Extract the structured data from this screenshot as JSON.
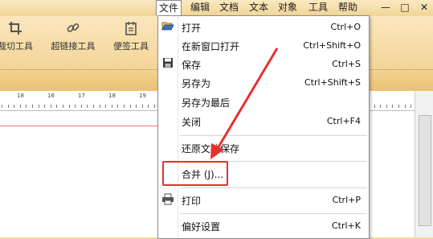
{
  "menubar": {
    "items": [
      "文件",
      "编辑",
      "文档",
      "文本",
      "对象",
      "工具",
      "帮助"
    ],
    "window_controls": [
      "—",
      "□",
      "✕"
    ]
  },
  "toolbar": {
    "tools": [
      {
        "label": "裁切工具",
        "icon": "crop-icon"
      },
      {
        "label": "超链接工具",
        "icon": "link-icon"
      },
      {
        "label": "便签工具",
        "icon": "note-icon"
      }
    ]
  },
  "ruler": {
    "labels": [
      "18",
      "16",
      "17",
      "18",
      "19"
    ]
  },
  "file_menu": {
    "items": [
      {
        "label": "打开",
        "shortcut": "Ctrl+O",
        "icon": "open-folder-icon"
      },
      {
        "label": "在新窗口打开",
        "shortcut": "Ctrl+Shift+O"
      },
      {
        "label": "保存",
        "shortcut": "Ctrl+S",
        "icon": "save-disk-icon"
      },
      {
        "label": "另存为",
        "shortcut": "Ctrl+Shift+S"
      },
      {
        "label": "另存为最后",
        "shortcut": ""
      },
      {
        "label": "关闭",
        "shortcut": "Ctrl+F4"
      },
      {
        "label": "还原文档保存",
        "shortcut": ""
      },
      {
        "label": "合并 (J)...",
        "shortcut": ""
      },
      {
        "label": "打印",
        "shortcut": "Ctrl+P",
        "icon": "printer-icon"
      },
      {
        "label": "偏好设置",
        "shortcut": "Ctrl+K"
      }
    ]
  },
  "colors": {
    "annotation": "#e5312d",
    "toolbar_bg": "#f3d598"
  }
}
